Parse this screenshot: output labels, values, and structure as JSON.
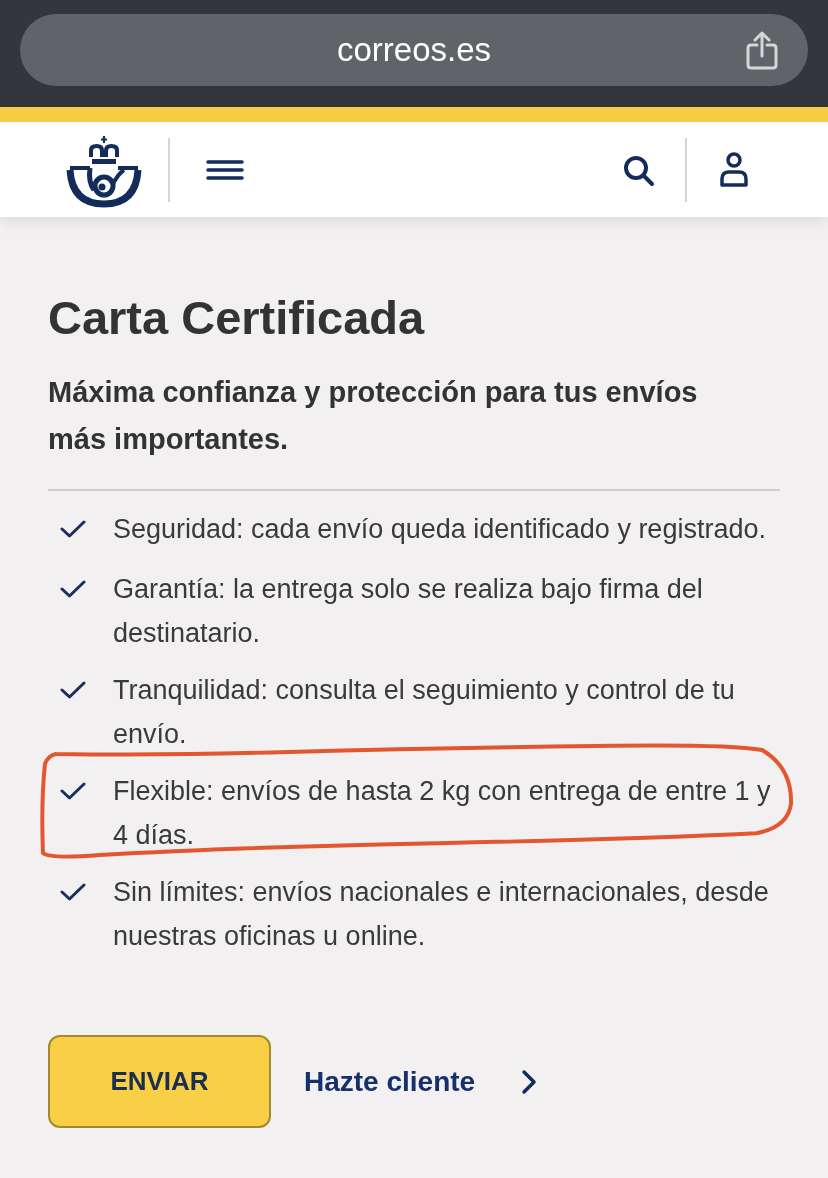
{
  "browser": {
    "url": "correos.es"
  },
  "title": "Carta Certificada",
  "subtitle": "Máxima confianza y protección para tus envíos más importantes.",
  "features": [
    {
      "text": "Seguridad: cada envío queda identificado y registrado.",
      "circled": false
    },
    {
      "text": "Garantía: la entrega solo se realiza bajo firma del destinatario.",
      "circled": false
    },
    {
      "text": "Tranquilidad: consulta el seguimiento y control de tu envío.",
      "circled": false
    },
    {
      "text": "Flexible: envíos de hasta 2 kg con entrega de entre 1 y 4 días.",
      "circled": true
    },
    {
      "text": "Sin límites: envíos nacionales e internacionales, desde nuestras oficinas u online.",
      "circled": false
    }
  ],
  "actions": {
    "primary": "ENVIAR",
    "link": "Hazte cliente"
  }
}
